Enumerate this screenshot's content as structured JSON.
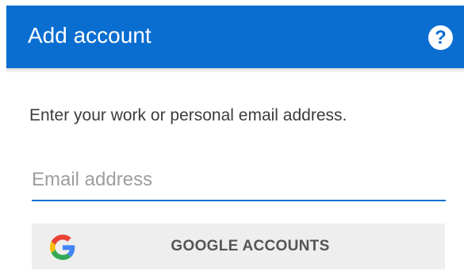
{
  "appbar": {
    "title": "Add account",
    "help_symbol": "?",
    "background_color": "#0a6ed1"
  },
  "form": {
    "prompt": "Enter your work or personal email address.",
    "email_placeholder": "Email address",
    "email_value": ""
  },
  "google_button": {
    "label": "GOOGLE ACCOUNTS",
    "icon": "google-g-icon"
  }
}
